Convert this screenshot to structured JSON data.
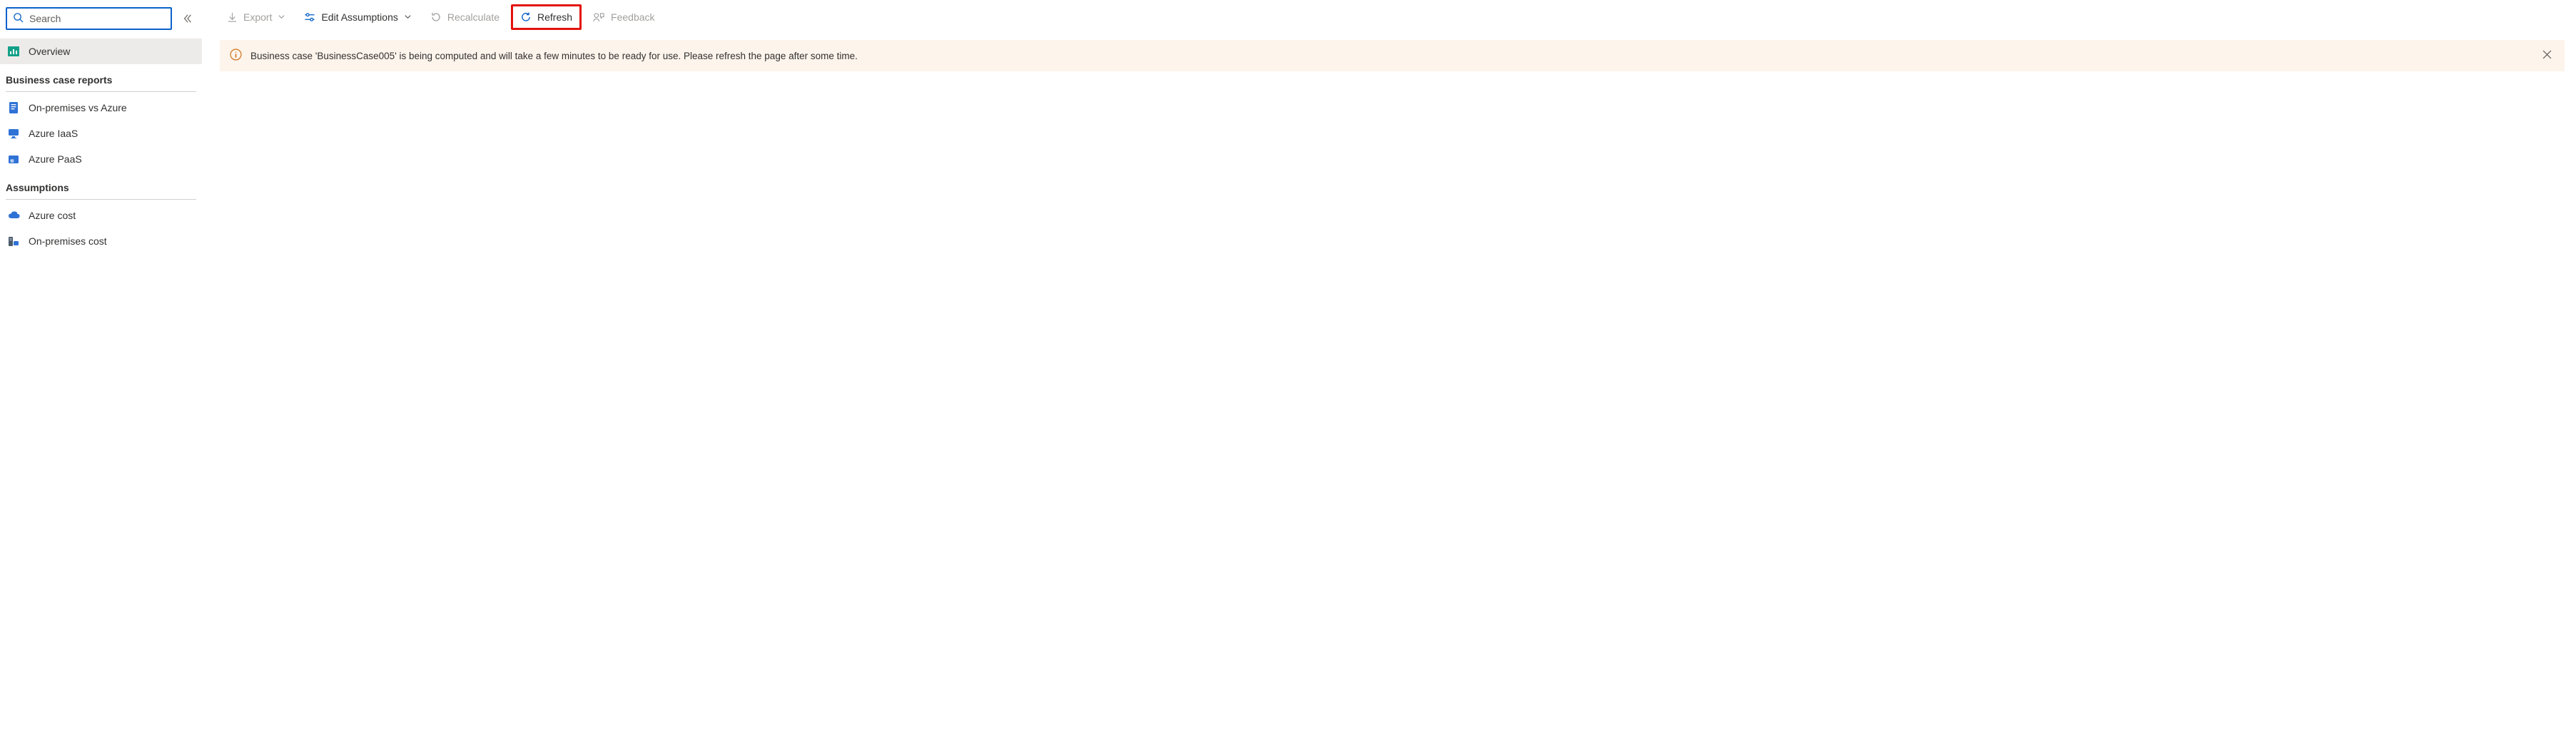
{
  "search": {
    "placeholder": "Search"
  },
  "sidebar": {
    "overview_label": "Overview",
    "section_reports": "Business case reports",
    "items_reports": [
      {
        "label": "On-premises vs Azure"
      },
      {
        "label": "Azure IaaS"
      },
      {
        "label": "Azure PaaS"
      }
    ],
    "section_assumptions": "Assumptions",
    "items_assumptions": [
      {
        "label": "Azure cost"
      },
      {
        "label": "On-premises cost"
      }
    ]
  },
  "toolbar": {
    "export_label": "Export",
    "edit_label": "Edit Assumptions",
    "recalc_label": "Recalculate",
    "refresh_label": "Refresh",
    "feedback_label": "Feedback"
  },
  "notice": {
    "text": "Business case 'BusinessCase005' is being computed and will take a few minutes to be ready for use. Please refresh the page after some time."
  }
}
